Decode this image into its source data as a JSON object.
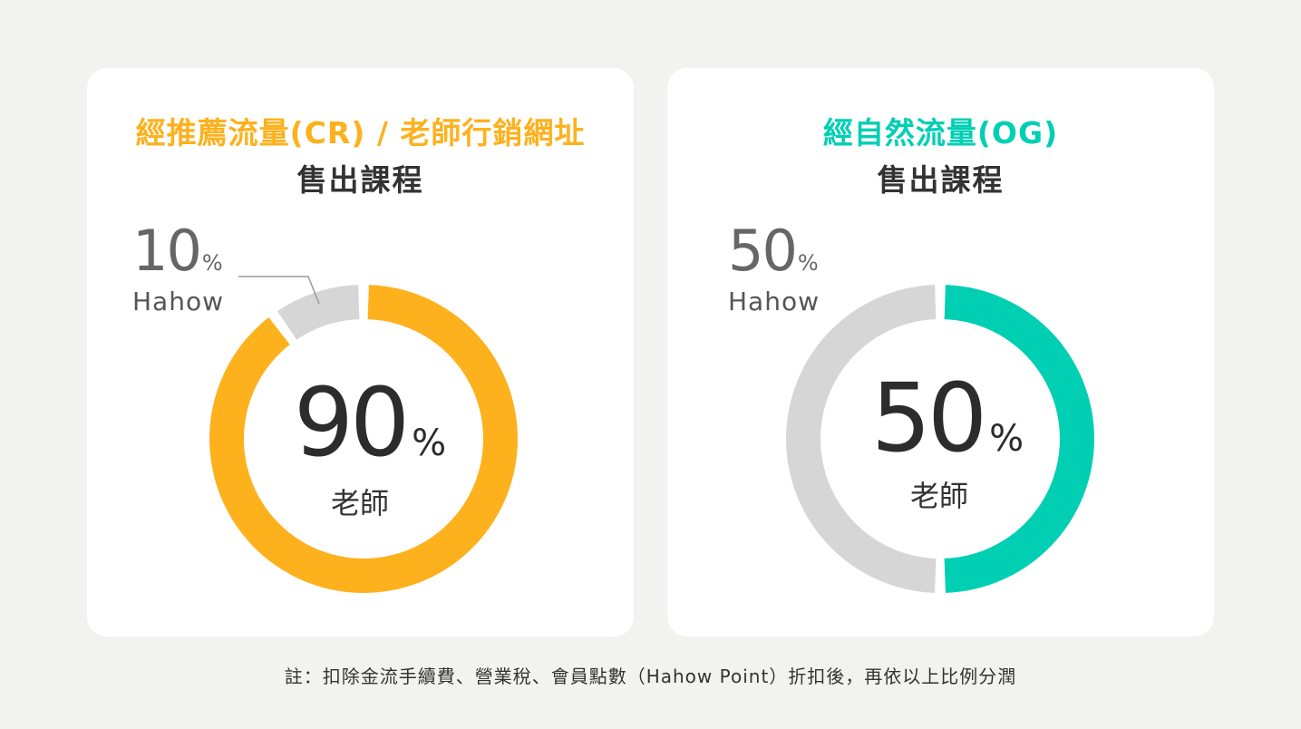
{
  "chart_data": [
    {
      "type": "pie",
      "title": "經推薦流量(CR) / 老師行銷網址",
      "subtitle": "售出課程",
      "slices": [
        {
          "label": "老師",
          "value": 90,
          "color": "#fdb11d"
        },
        {
          "label": "Hahow",
          "value": 10,
          "color": "#d6d6d6"
        }
      ],
      "center_value": "90",
      "center_unit": "%",
      "center_label": "老師",
      "callout_value": "10",
      "callout_unit": "%",
      "callout_label": "Hahow",
      "title_color": "#fdb11d"
    },
    {
      "type": "pie",
      "title": "經自然流量(OG)",
      "subtitle": "售出課程",
      "slices": [
        {
          "label": "老師",
          "value": 50,
          "color": "#00cfb4"
        },
        {
          "label": "Hahow",
          "value": 50,
          "color": "#d6d6d6"
        }
      ],
      "center_value": "50",
      "center_unit": "%",
      "center_label": "老師",
      "callout_value": "50",
      "callout_unit": "%",
      "callout_label": "Hahow",
      "title_color": "#00cfb4"
    }
  ],
  "footnote": "註：扣除金流手續費、營業稅、會員點數（Hahow Point）折扣後，再依以上比例分潤"
}
